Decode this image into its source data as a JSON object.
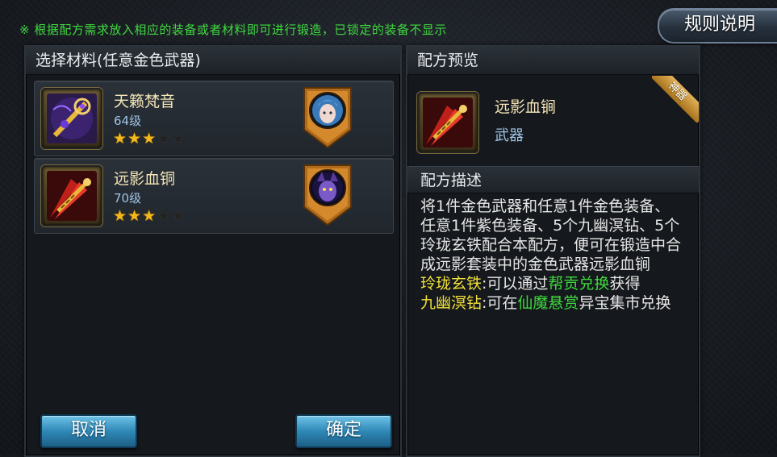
{
  "notice": "※ 根据配方需求放入相应的装备或者材料即可进行锻造，已锁定的装备不显示",
  "rules_button": "规则说明",
  "left_panel": {
    "title": "选择材料(任意金色武器)",
    "items": [
      {
        "name": "天籁梵音",
        "level": "64级",
        "stars_filled": 3,
        "stars_total": 5,
        "icon": "golden-staff-icon",
        "badge_icon": "female-hero-portrait-icon"
      },
      {
        "name": "远影血铜",
        "level": "70级",
        "stars_filled": 3,
        "stars_total": 5,
        "icon": "red-blade-icon",
        "badge_icon": "demon-hero-portrait-icon"
      }
    ],
    "cancel_label": "取消",
    "confirm_label": "确定"
  },
  "right_panel": {
    "preview_title": "配方预览",
    "preview_item": {
      "name": "远影血锏",
      "type": "武器",
      "ribbon": "神器"
    },
    "desc_title": "配方描述",
    "desc_main": "将1件金色武器和任意1件金色装备、任意1件紫色装备、5个九幽溟钻、5个玲珑玄铁配合本配方，便可在锻造中合成远影套装中的金色武器远影血锏",
    "line2_label": "玲珑玄铁",
    "line2_mid": ":可以通过",
    "line2_link": "帮贡兑换",
    "line2_end": "获得",
    "line3_label": "九幽溟钻",
    "line3_mid": ":可在",
    "line3_link": "仙魔悬赏",
    "line3_end": "异宝集市兑换"
  },
  "colors": {
    "notice_green": "#3fd93f",
    "star_gold": "#f3b81c",
    "button_blue": "#2f88b6",
    "highlight_yellow": "#f2e23a"
  }
}
